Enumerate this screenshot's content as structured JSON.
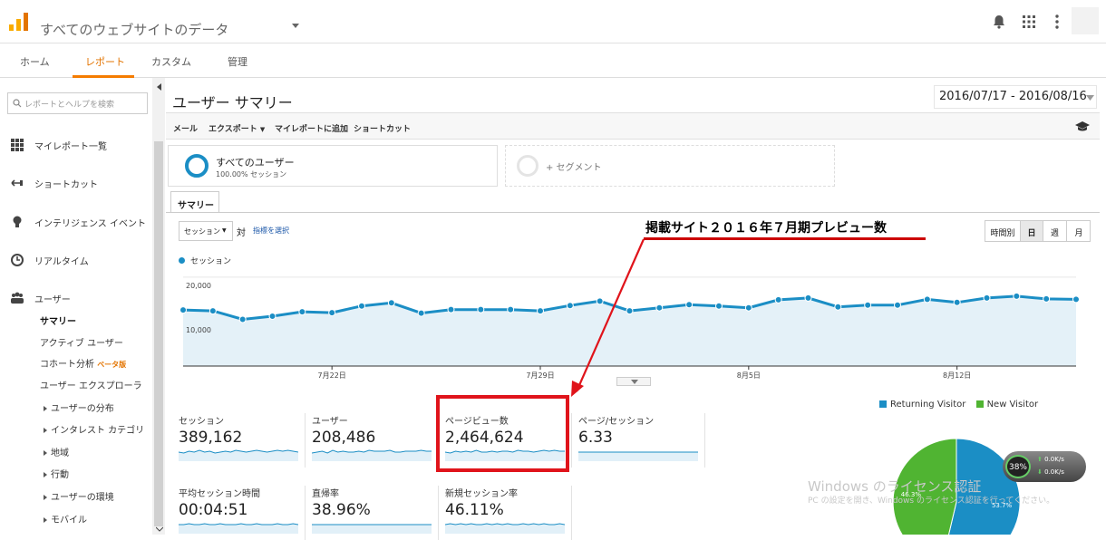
{
  "header": {
    "property_name": "すべてのウェブサイトのデータ"
  },
  "tabs": [
    {
      "label": "ホーム"
    },
    {
      "label": "レポート"
    },
    {
      "label": "カスタム"
    },
    {
      "label": "管理"
    }
  ],
  "sidebar": {
    "search_placeholder": "レポートとヘルプを検索",
    "items": [
      {
        "label": "マイレポート一覧"
      },
      {
        "label": "ショートカット"
      },
      {
        "label": "インテリジェンス イベント"
      },
      {
        "label": "リアルタイム"
      },
      {
        "label": "ユーザー"
      }
    ],
    "subitems": [
      {
        "label": "サマリー"
      },
      {
        "label": "アクティブ ユーザー"
      },
      {
        "label": "コホート分析"
      },
      {
        "label": "ユーザー エクスプローラ"
      },
      {
        "label": "ユーザーの分布"
      },
      {
        "label": "インタレスト カテゴリ"
      },
      {
        "label": "地域"
      },
      {
        "label": "行動"
      },
      {
        "label": "ユーザーの環境"
      },
      {
        "label": "モバイル"
      }
    ],
    "beta_label": "ベータ版"
  },
  "report": {
    "title": "ユーザー サマリー",
    "date_range": "2016/07/17 - 2016/08/16",
    "actions": [
      {
        "label": "メール"
      },
      {
        "label": "エクスポート"
      },
      {
        "label": "マイレポートに追加"
      },
      {
        "label": "ショートカット"
      }
    ],
    "segment": {
      "title": "すべてのユーザー",
      "subtitle": "100.00% セッション",
      "add_label": "+ セグメント"
    },
    "summary_tab": "サマリー",
    "metric_select": "セッション",
    "vs_label": "対",
    "choose_metric": "指標を選択",
    "legend_label": "セッション",
    "granularity": [
      {
        "label": "時間別"
      },
      {
        "label": "日"
      },
      {
        "label": "週"
      },
      {
        "label": "月"
      }
    ],
    "annotation": "掲載サイト２０１６年７月期プレビュー数"
  },
  "chart_data": {
    "type": "area",
    "series": [
      {
        "name": "セッション",
        "values": [
          12600,
          12400,
          10500,
          11200,
          12200,
          12000,
          13500,
          14200,
          11900,
          12700,
          12700,
          12700,
          12400,
          13600,
          14600,
          12400,
          13100,
          13800,
          13500,
          13100,
          14900,
          15300,
          13300,
          13700,
          13700,
          15000,
          14300,
          15300,
          15700,
          15100,
          15000
        ]
      }
    ],
    "yticks": [
      "20,000",
      "10,000"
    ],
    "ylim": [
      0,
      22000
    ],
    "xtick_labels": [
      "7月22日",
      "7月29日",
      "8月5日",
      "8月12日"
    ],
    "xtick_index": [
      5,
      12,
      19,
      26
    ],
    "color": "#1b8ec5"
  },
  "metrics": [
    {
      "label": "セッション",
      "value": "389,162"
    },
    {
      "label": "ユーザー",
      "value": "208,486"
    },
    {
      "label": "ページビュー数",
      "value": "2,464,624"
    },
    {
      "label": "ページ/セッション",
      "value": "6.33"
    },
    {
      "label": "平均セッション時間",
      "value": "00:04:51"
    },
    {
      "label": "直帰率",
      "value": "38.96%"
    },
    {
      "label": "新規セッション率",
      "value": "46.11%"
    }
  ],
  "pie": {
    "legend": [
      {
        "label": "Returning Visitor",
        "color": "#1b8ec5"
      },
      {
        "label": "New Visitor",
        "color": "#50b432"
      }
    ],
    "slices": [
      53.7,
      46.3
    ],
    "labels": [
      "53.7%",
      "46.3%"
    ]
  },
  "network_widget": {
    "percent": "38%",
    "up": "0.0K/s",
    "down": "0.0K/s"
  },
  "watermark": {
    "title": "Windows のライセンス認証",
    "subtitle": "PC の設定を開き、Windows のライセンス認証を行ってください。"
  }
}
